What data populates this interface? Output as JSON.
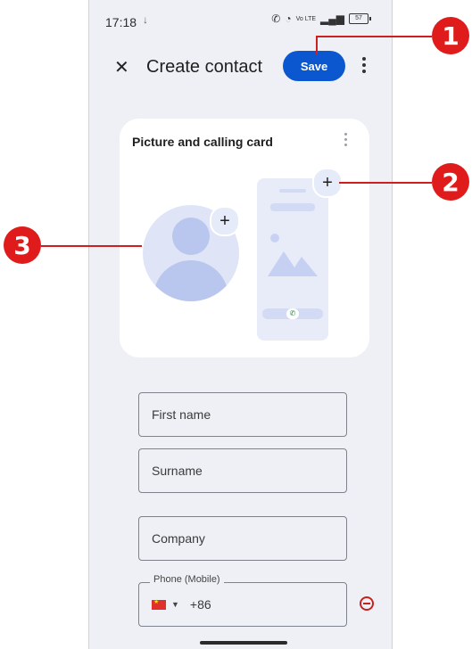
{
  "status_bar": {
    "time": "17:18",
    "download_icon": "↓",
    "signal_text": "Vo LTE",
    "battery": "57"
  },
  "app_bar": {
    "close_symbol": "✕",
    "title": "Create contact",
    "save_label": "Save"
  },
  "picture_card": {
    "title": "Picture and calling card",
    "add_symbol": "+"
  },
  "form": {
    "first_name_placeholder": "First name",
    "surname_placeholder": "Surname",
    "company_placeholder": "Company",
    "phone_label": "Phone (Mobile)",
    "phone_country_code": "+86",
    "caret": "▼"
  },
  "callouts": [
    {
      "number": "1"
    },
    {
      "number": "2"
    },
    {
      "number": "3"
    }
  ],
  "colors": {
    "accent": "#0b57d0",
    "callout": "#e01b1b",
    "remove": "#c5221f"
  }
}
